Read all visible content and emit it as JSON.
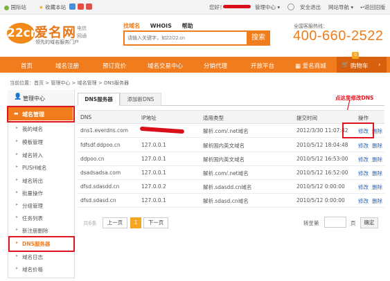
{
  "topbar": {
    "intl": "国际站",
    "fav": "收藏本站",
    "greeting": "您好！",
    "manage": "管理中心",
    "logout": "安全退出",
    "sitenav": "网站导航",
    "back_home": "返回旧版"
  },
  "header": {
    "logo_circle": "22cn",
    "logo_name": "爱名网",
    "logo_isp_1": "电信",
    "logo_isp_2": "网通",
    "logo_tag": "领先的域名服务门户",
    "nav": [
      "找域名",
      "WHOIS",
      "帮助"
    ],
    "search_placeholder": "请输入关键字，如22/22.cn",
    "search_btn": "搜索",
    "hotline_label": "全国客服热线：",
    "hotline": "400-660-2522"
  },
  "mainnav": {
    "items": [
      "首页",
      "域名注册",
      "预订竞价",
      "域名交易中心",
      "分销代理",
      "开放平台",
      "爱名商城"
    ],
    "cart": "购物车",
    "cart_count": "0"
  },
  "breadcrumb": "当前位置：首页 > 管理中心 > 域名管理 > DNS服务器",
  "sidebar": {
    "header": "管理中心",
    "section": "域名管理",
    "items": [
      "我的域名",
      "模板管理",
      "域名转入",
      "PUSH域名",
      "域名转出",
      "批量操作",
      "分组管理",
      "任务列表",
      "新注册删除",
      "DNS服务器",
      "域名日志",
      "域名价格"
    ]
  },
  "tabs": [
    "DNS服务器",
    "添加新DNS"
  ],
  "annotation": "点这里修改DNS",
  "table": {
    "headers": [
      "DNS",
      "IP地址",
      "适用类型",
      "提交时间",
      "操作"
    ],
    "rows": [
      {
        "dns": "dns1.everdns.com",
        "ip": "",
        "type": "解析.com/.net域名",
        "time": "2012/3/30 11:07:42"
      },
      {
        "dns": "fdfsdf.ddpoo.cn",
        "ip": "127.0.0.1",
        "type": "解析国内英文域名",
        "time": "2010/5/12 18:04:48"
      },
      {
        "dns": "ddpoo.cn",
        "ip": "127.0.0.1",
        "type": "解析国内英文域名",
        "time": "2010/5/12 16:53:00"
      },
      {
        "dns": "dsadsadsa.com",
        "ip": "127.0.0.1",
        "type": "解析.com/.net域名",
        "time": "2010/5/12 16:52:00"
      },
      {
        "dns": "dfsd.sdasdd.cn",
        "ip": "127.0.0.2",
        "type": "解析.sdasdd.cn域名",
        "time": "2010/5/12 0:00:00"
      },
      {
        "dns": "dfsd.sdasd.cn",
        "ip": "127.0.0.1",
        "type": "解析.sdasd.cn域名",
        "time": "2010/5/12 0:00:00"
      }
    ],
    "edit": "修改",
    "delete": "删除"
  },
  "pagination": {
    "total": "共6条",
    "prev": "上一页",
    "current": "1",
    "next": "下一页",
    "goto": "转至第",
    "page": "页",
    "confirm": "确定"
  },
  "colors": {
    "accent": "#f07c1d",
    "annotation": "#e0141e",
    "link": "#2a66b8"
  }
}
